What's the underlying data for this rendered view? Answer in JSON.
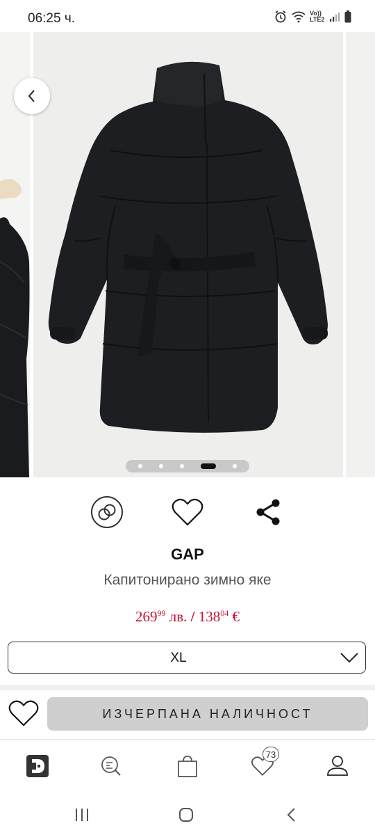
{
  "status_bar": {
    "time": "06:25 ч.",
    "network_label": "Vo)) LTE2",
    "icons": [
      "alarm-icon",
      "wifi-icon",
      "signal-icon",
      "battery-icon"
    ]
  },
  "gallery": {
    "back_icon": "chevron-left-icon",
    "slide_count": 5,
    "active_slide": 4
  },
  "actions": {
    "icons": [
      "compare-rings-icon",
      "heart-icon",
      "share-icon"
    ]
  },
  "product": {
    "brand": "GAP",
    "name": "Капитонирано зимно яке",
    "price_bgn_main": "269",
    "price_bgn_cents": "99",
    "price_bgn_currency": "лв.",
    "price_separator": "/",
    "price_eur_main": "138",
    "price_eur_cents": "04",
    "price_eur_currency": "€"
  },
  "size_select": {
    "value": "XL"
  },
  "cta": {
    "label": "ИЗЧЕРПАНА НАЛИЧНОСТ"
  },
  "bottom_nav": {
    "items": [
      "home-logo-icon",
      "search-icon",
      "bag-icon",
      "wishlist-heart-icon",
      "account-icon"
    ],
    "wishlist_count": "73"
  },
  "colors": {
    "price": "#c8102e",
    "soldout_bg": "#cfcfcf"
  }
}
